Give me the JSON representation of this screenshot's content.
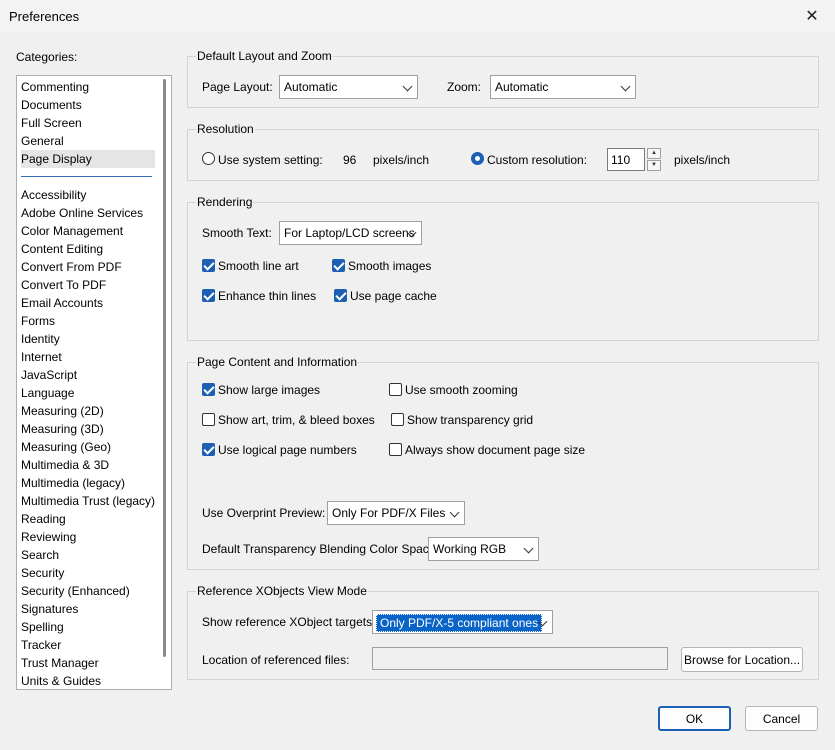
{
  "window": {
    "title": "Preferences"
  },
  "categories": {
    "label": "Categories:",
    "top_items": [
      "Commenting",
      "Documents",
      "Full Screen",
      "General",
      "Page Display"
    ],
    "items": [
      "Accessibility",
      "Adobe Online Services",
      "Color Management",
      "Content Editing",
      "Convert From PDF",
      "Convert To PDF",
      "Email Accounts",
      "Forms",
      "Identity",
      "Internet",
      "JavaScript",
      "Language",
      "Measuring (2D)",
      "Measuring (3D)",
      "Measuring (Geo)",
      "Multimedia & 3D",
      "Multimedia (legacy)",
      "Multimedia Trust (legacy)",
      "Reading",
      "Reviewing",
      "Search",
      "Security",
      "Security (Enhanced)",
      "Signatures",
      "Spelling",
      "Tracker",
      "Trust Manager",
      "Units & Guides"
    ],
    "selected": "Page Display"
  },
  "layout_zoom": {
    "title": "Default Layout and Zoom",
    "page_layout_label": "Page Layout:",
    "page_layout_value": "Automatic",
    "zoom_label": "Zoom:",
    "zoom_value": "Automatic"
  },
  "resolution": {
    "title": "Resolution",
    "system_label": "Use system setting:",
    "system_value": "96",
    "system_unit": "pixels/inch",
    "custom_label": "Custom resolution:",
    "custom_value": "110",
    "custom_unit": "pixels/inch"
  },
  "rendering": {
    "title": "Rendering",
    "smooth_text_label": "Smooth Text:",
    "smooth_text_value": "For Laptop/LCD screens",
    "smooth_line_art": "Smooth line art",
    "smooth_images": "Smooth images",
    "enhance_thin_lines": "Enhance thin lines",
    "use_page_cache": "Use page cache"
  },
  "page_content": {
    "title": "Page Content and Information",
    "show_large_images": "Show large images",
    "use_smooth_zooming": "Use smooth zooming",
    "show_art_trim": "Show art, trim, & bleed boxes",
    "show_transparency_grid": "Show transparency grid",
    "use_logical_page_numbers": "Use logical page numbers",
    "always_show_doc_page_size": "Always show document page size",
    "overprint_label": "Use Overprint Preview:",
    "overprint_value": "Only For PDF/X Files",
    "blending_label": "Default Transparency Blending Color Space:",
    "blending_value": "Working RGB"
  },
  "xobjects": {
    "title": "Reference XObjects View Mode",
    "targets_label": "Show reference XObject targets:",
    "targets_value": "Only PDF/X-5 compliant ones",
    "location_label": "Location of referenced files:",
    "location_value": "",
    "browse_label": "Browse for Location..."
  },
  "footer": {
    "ok_label": "OK",
    "cancel_label": "Cancel"
  },
  "colors": {
    "accent": "#1d5fb2",
    "selection_highlight": "#0a64c8"
  },
  "icons": {
    "close": "close-icon",
    "dropdown": "chevron-down-icon"
  }
}
